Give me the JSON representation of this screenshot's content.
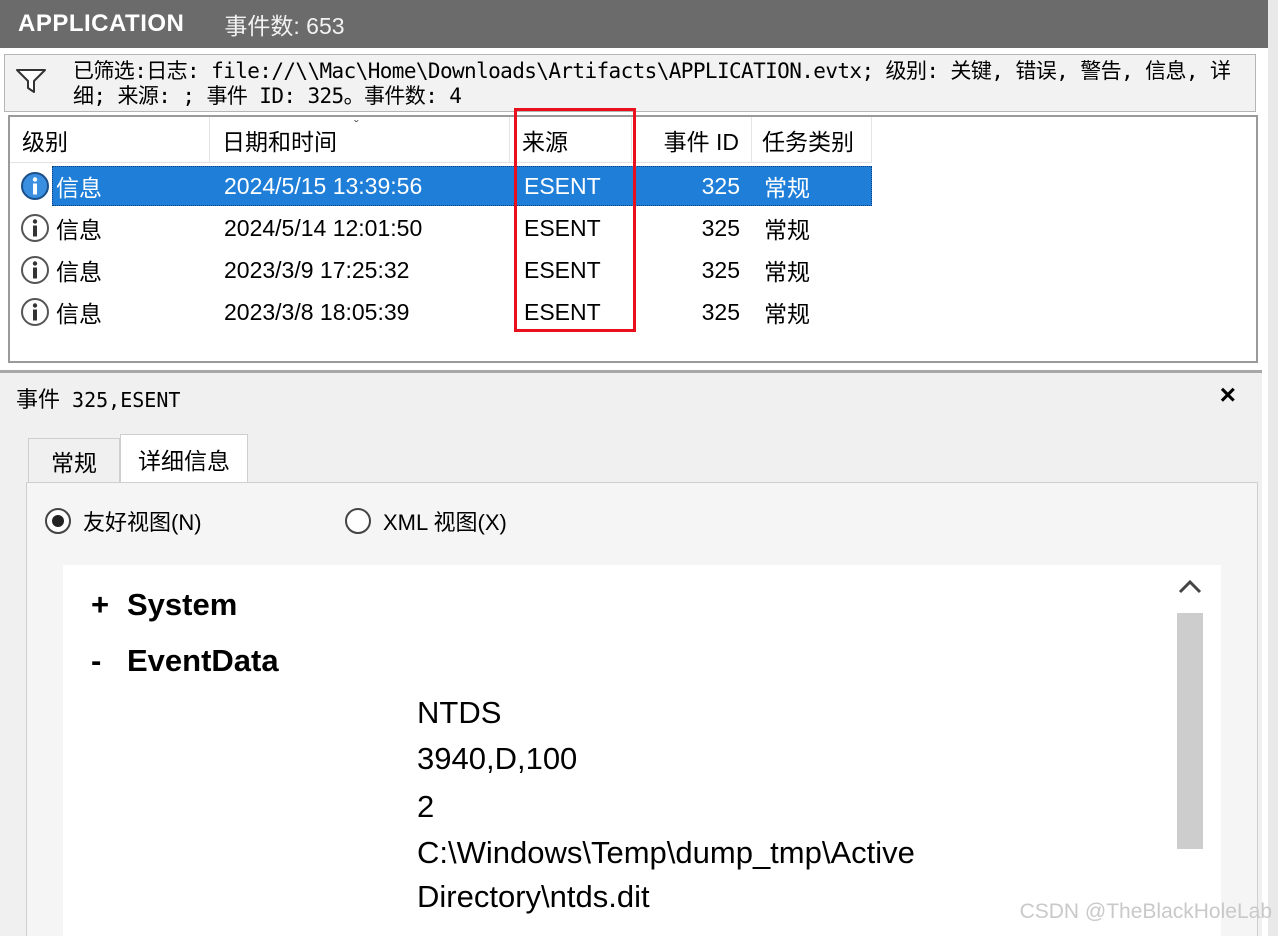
{
  "header": {
    "app_name": "APPLICATION",
    "event_count": "事件数: 653"
  },
  "filter": {
    "icon": "funnel-icon",
    "text": "已筛选:日志: file://\\\\Mac\\Home\\Downloads\\Artifacts\\APPLICATION.evtx; 级别: 关键, 错误, 警告, 信息, 详细; 来源: ; 事件 ID: 325。事件数: 4"
  },
  "table": {
    "columns": [
      "级别",
      "日期和时间",
      "来源",
      "事件 ID",
      "任务类别"
    ],
    "sort_marker": "ˇ",
    "rows": [
      {
        "level": "信息",
        "datetime": "2024/5/15 13:39:56",
        "source": "ESENT",
        "event_id": "325",
        "task": "常规",
        "selected": true
      },
      {
        "level": "信息",
        "datetime": "2024/5/14 12:01:50",
        "source": "ESENT",
        "event_id": "325",
        "task": "常规",
        "selected": false
      },
      {
        "level": "信息",
        "datetime": "2023/3/9 17:25:32",
        "source": "ESENT",
        "event_id": "325",
        "task": "常规",
        "selected": false
      },
      {
        "level": "信息",
        "datetime": "2023/3/8 18:05:39",
        "source": "ESENT",
        "event_id": "325",
        "task": "常规",
        "selected": false
      }
    ]
  },
  "detail": {
    "title_prefix": "事件",
    "title_rest": " 325,ESENT",
    "close": "×",
    "tabs": [
      "常规",
      "详细信息"
    ],
    "radio_friendly": "友好视图(N)",
    "radio_xml": "XML 视图(X)",
    "system_symbol": "+",
    "system_label": "System",
    "eventdata_symbol": "-",
    "eventdata_label": "EventData",
    "event_data_lines": [
      "NTDS",
      "3940,D,100",
      "2",
      "C:\\Windows\\Temp\\dump_tmp\\Active",
      "Directory\\ntds.dit"
    ]
  },
  "watermark": "CSDN @TheBlackHoleLab",
  "colors": {
    "header_bg": "#6b6b6b",
    "selection": "#1e7ed8",
    "highlight_box": "#e8101c"
  }
}
